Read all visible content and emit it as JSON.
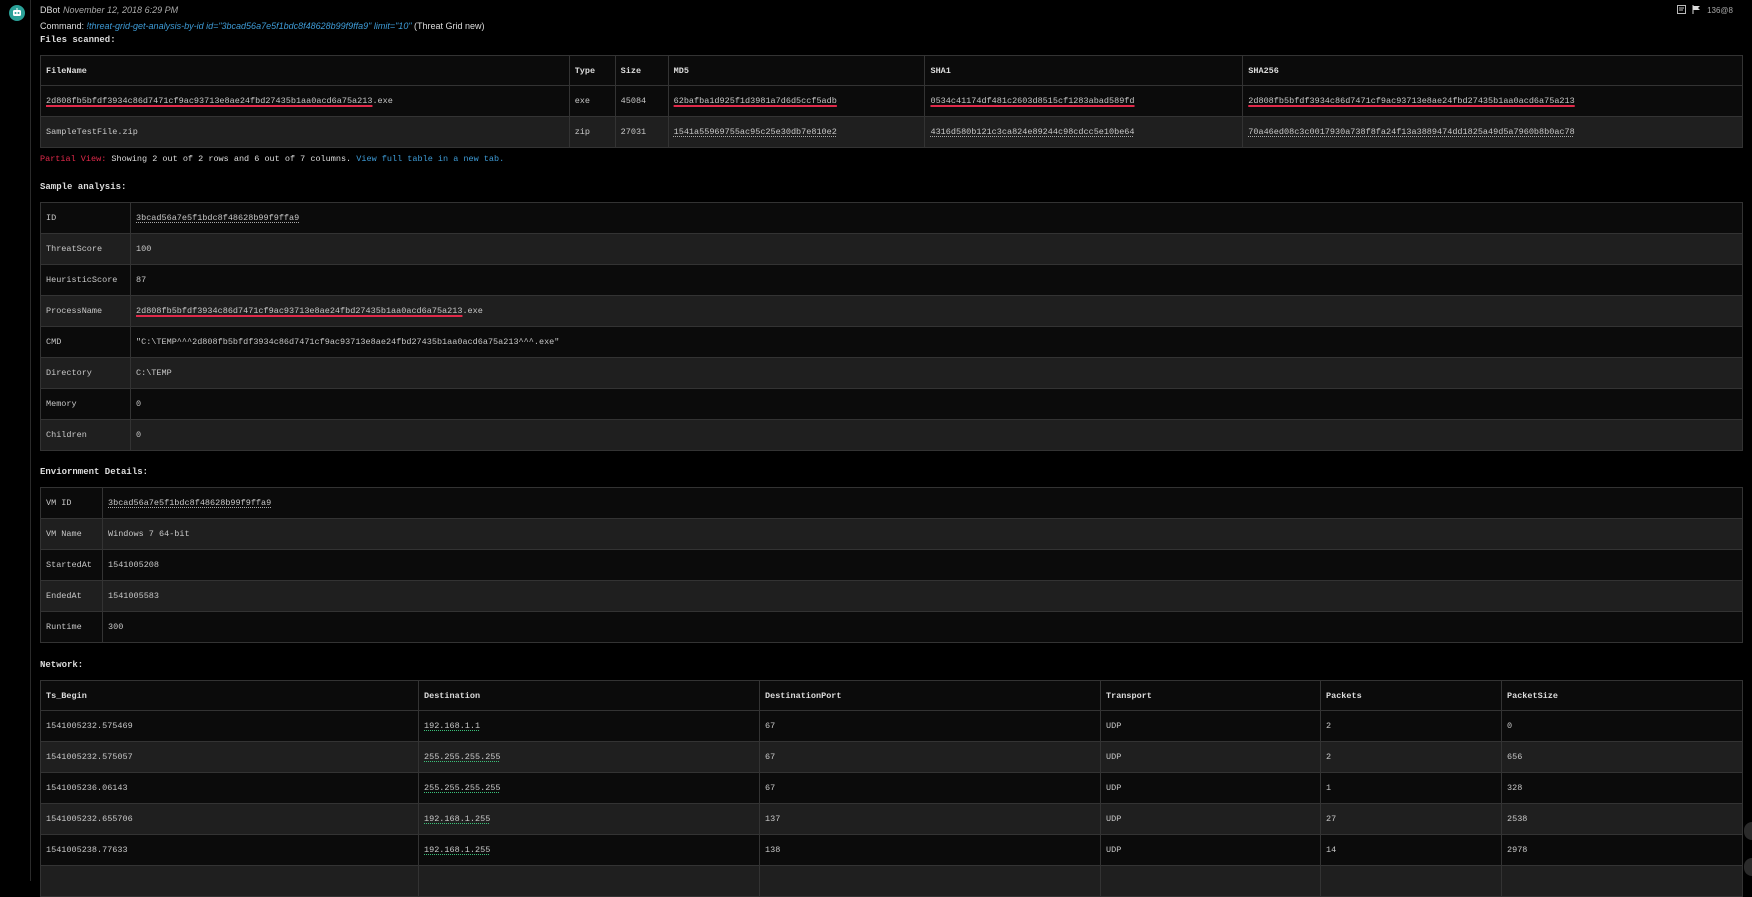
{
  "header": {
    "author": "DBot",
    "timestamp": "November 12, 2018 6:29 PM",
    "entry_id": "136@8"
  },
  "command": {
    "prefix": "Command:",
    "text": "!threat-grid-get-analysis-by-id id=\"3bcad56a7e5f1bdc8f48628b99f9ffa9\" limit=\"10\"",
    "integration": "(Threat Grid new)"
  },
  "files_scanned": {
    "title": "Files scanned:",
    "columns": [
      "FileName",
      "Type",
      "Size",
      "MD5",
      "SHA1",
      "SHA256"
    ],
    "rows": [
      {
        "filename_hash": "2d808fb5bfdf3934c86d7471cf9ac93713e8ae24fbd27435b1aa0acd6a75a213",
        "filename_ext": ".exe",
        "type": "exe",
        "size": "45084",
        "md5": "62bafba1d925f1d3981a7d6d5ccf5adb",
        "sha1": "0534c41174df481c2603d8515cf1283abad589fd",
        "sha256": "2d808fb5bfdf3934c86d7471cf9ac93713e8ae24fbd27435b1aa0acd6a75a213"
      },
      {
        "filename_hash": "SampleTestFile.zip",
        "filename_ext": "",
        "type": "zip",
        "size": "27031",
        "md5": "1541a55969755ac95c25e30db7e810e2",
        "sha1": "4316d580b121c3ca824e89244c98cdcc5e10be64",
        "sha256": "70a46ed08c3c0017930a738f8fa24f13a3889474dd1825a49d5a7960b8b0ac78"
      }
    ]
  },
  "partial_view": {
    "label": "Partial View:",
    "text": "Showing 2 out of 2 rows and 6 out of 7 columns.",
    "link": "View full table in a new tab."
  },
  "sample_analysis": {
    "title": "Sample analysis:",
    "rows": [
      {
        "key": "ID",
        "value": "3bcad56a7e5f1bdc8f48628b99f9ffa9"
      },
      {
        "key": "ThreatScore",
        "value": "100"
      },
      {
        "key": "HeuristicScore",
        "value": "87"
      },
      {
        "key": "ProcessName",
        "value": "2d808fb5bfdf3934c86d7471cf9ac93713e8ae24fbd27435b1aa0acd6a75a213",
        "suffix": ".exe"
      },
      {
        "key": "CMD",
        "value": "\"C:\\TEMP^^^2d808fb5bfdf3934c86d7471cf9ac93713e8ae24fbd27435b1aa0acd6a75a213^^^.exe\""
      },
      {
        "key": "Directory",
        "value": "C:\\TEMP"
      },
      {
        "key": "Memory",
        "value": "0"
      },
      {
        "key": "Children",
        "value": "0"
      }
    ]
  },
  "environment": {
    "title": "Enviornment Details:",
    "rows": [
      {
        "key": "VM ID",
        "value": "3bcad56a7e5f1bdc8f48628b99f9ffa9"
      },
      {
        "key": "VM Name",
        "value": "Windows 7 64-bit"
      },
      {
        "key": "StartedAt",
        "value": "1541005208"
      },
      {
        "key": "EndedAt",
        "value": "1541005583"
      },
      {
        "key": "Runtime",
        "value": "300"
      }
    ]
  },
  "network": {
    "title": "Network:",
    "columns": [
      "Ts_Begin",
      "Destination",
      "DestinationPort",
      "Transport",
      "Packets",
      "PacketSize"
    ],
    "rows": [
      [
        "1541005232.575469",
        "192.168.1.1",
        "67",
        "UDP",
        "2",
        "0"
      ],
      [
        "1541005232.575057",
        "255.255.255.255",
        "67",
        "UDP",
        "2",
        "656"
      ],
      [
        "1541005236.06143",
        "255.255.255.255",
        "67",
        "UDP",
        "1",
        "328"
      ],
      [
        "1541005232.655706",
        "192.168.1.255",
        "137",
        "UDP",
        "27",
        "2538"
      ],
      [
        "1541005238.77633",
        "192.168.1.255",
        "138",
        "UDP",
        "14",
        "2978"
      ]
    ]
  },
  "colors": {
    "background": "#000000",
    "row_dark": "#0b0b0b",
    "row_light": "#1f1f1f",
    "accent_link": "#3e9bd6",
    "underline_red": "#e0294a",
    "avatar": "#2aa198"
  }
}
